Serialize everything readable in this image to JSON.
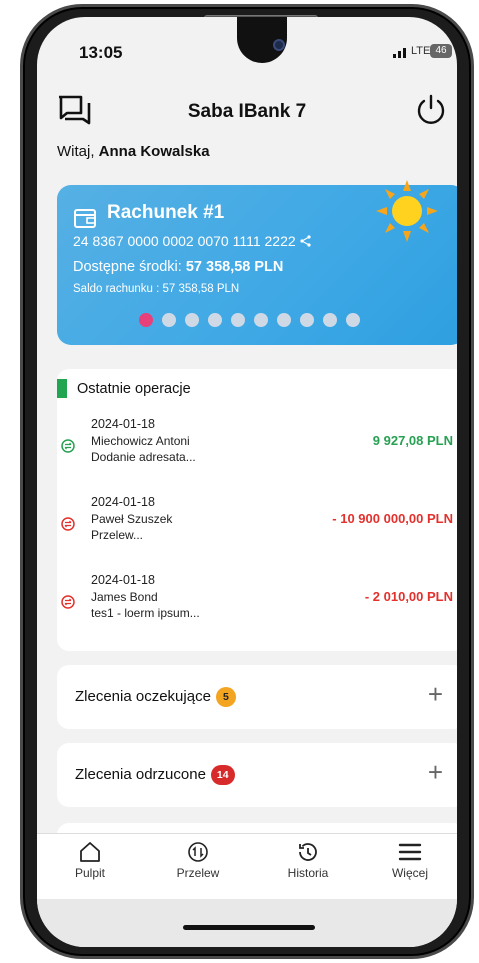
{
  "status": {
    "time": "13:05",
    "network": "LTE",
    "battery": "46"
  },
  "header": {
    "title": "Saba IBank 7"
  },
  "greeting": {
    "prefix": "Witaj, ",
    "name": "Anna Kowalska"
  },
  "account": {
    "title": "Rachunek #1",
    "iban": "24 8367 0000 0002 0070 1111 2222",
    "available_label": "Dostępne środki: ",
    "available_value": "57 358,58 PLN",
    "saldo": "Saldo rachunku : 57 358,58 PLN",
    "dots_total": 10,
    "dots_active": 1
  },
  "operations": {
    "title": "Ostatnie operacje",
    "items": [
      {
        "date": "2024-01-18",
        "name": "Miechowicz Antoni",
        "desc": "Dodanie adresata...",
        "amount": "9 927,08 PLN",
        "direction": "in"
      },
      {
        "date": "2024-01-18",
        "name": "Paweł Szuszek",
        "desc": "Przelew...",
        "amount": "- 10 900 000,00 PLN",
        "direction": "out"
      },
      {
        "date": "2024-01-18",
        "name": "James Bond",
        "desc": "tes1 - loerm ipsum...",
        "amount": "- 2 010,00 PLN",
        "direction": "out"
      }
    ]
  },
  "pending": {
    "label": "Zlecenia oczekujące",
    "count": "5"
  },
  "rejected": {
    "label": "Zlecenia odrzucone",
    "count": "14"
  },
  "nav": {
    "home": "Pulpit",
    "transfer": "Przelew",
    "history": "Historia",
    "more": "Więcej"
  },
  "colors": {
    "accent_blue": "#3ea8e5",
    "positive": "#27a052",
    "negative": "#e3312d",
    "active_dot": "#e8407a"
  }
}
